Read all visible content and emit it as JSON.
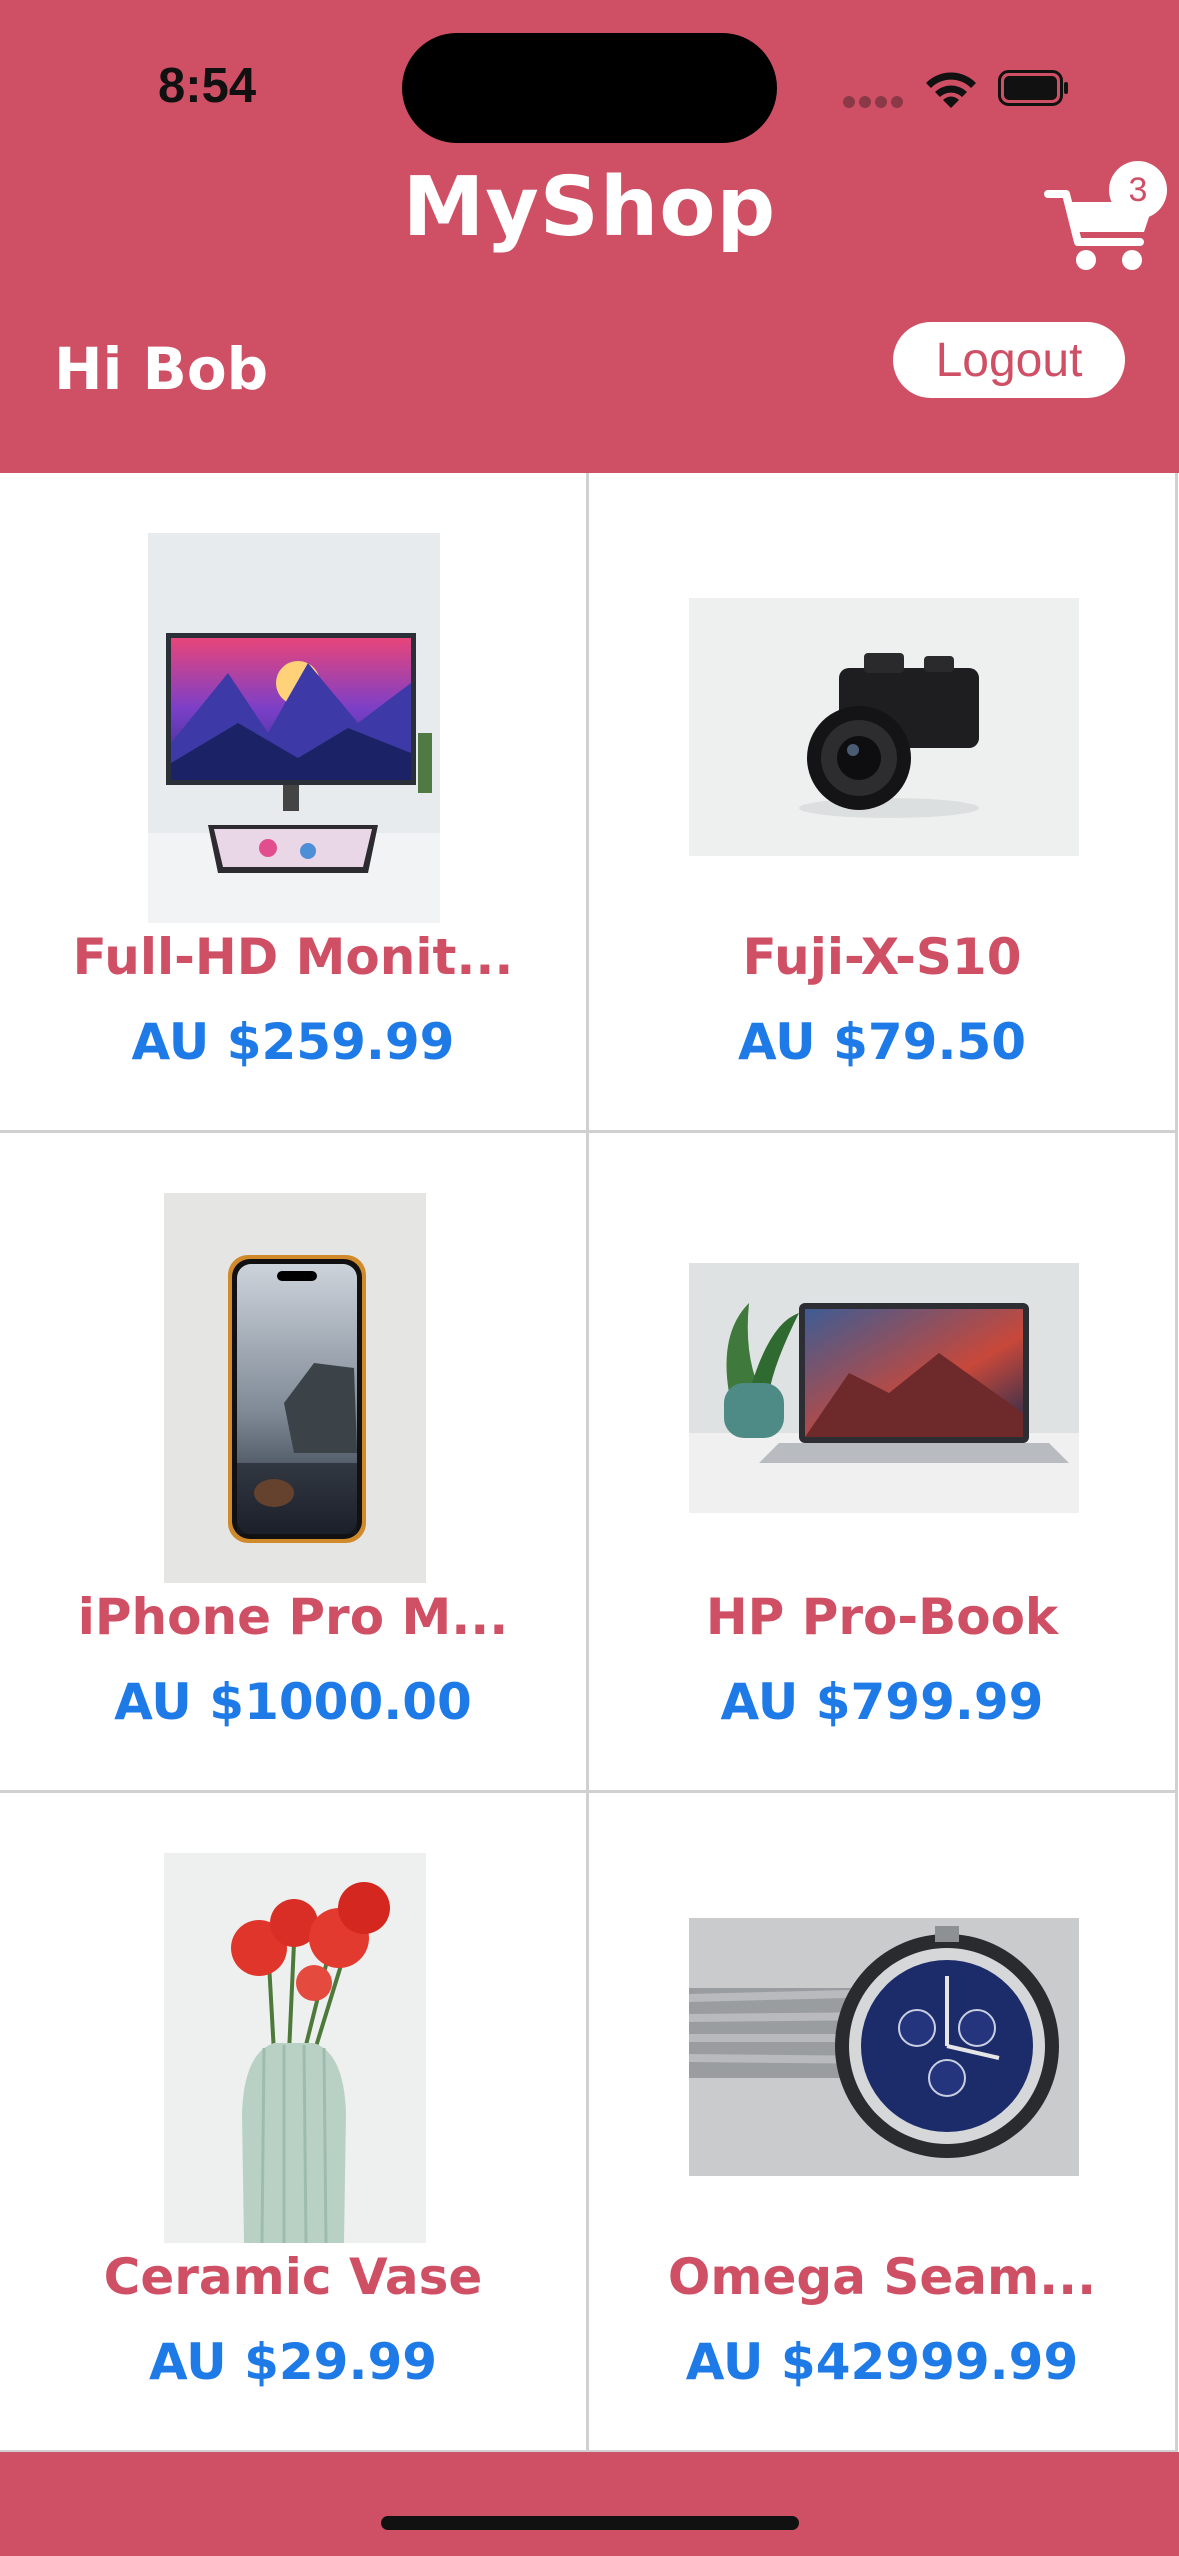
{
  "status_bar": {
    "time": "8:54"
  },
  "header": {
    "title": "MyShop",
    "cart_count": "3",
    "greeting": "Hi Bob",
    "logout_label": "Logout"
  },
  "colors": {
    "brand": "#cf5064",
    "price": "#1e7ae6"
  },
  "products": [
    {
      "name": "Full-HD Monit...",
      "price": "AU $259.99"
    },
    {
      "name": "Fuji-X-S10",
      "price": "AU $79.50"
    },
    {
      "name": "iPhone Pro M...",
      "price": "AU $1000.00"
    },
    {
      "name": "HP Pro-Book",
      "price": "AU $799.99"
    },
    {
      "name": "Ceramic Vase",
      "price": "AU $29.99"
    },
    {
      "name": "Omega Seam...",
      "price": "AU $42999.99"
    }
  ]
}
